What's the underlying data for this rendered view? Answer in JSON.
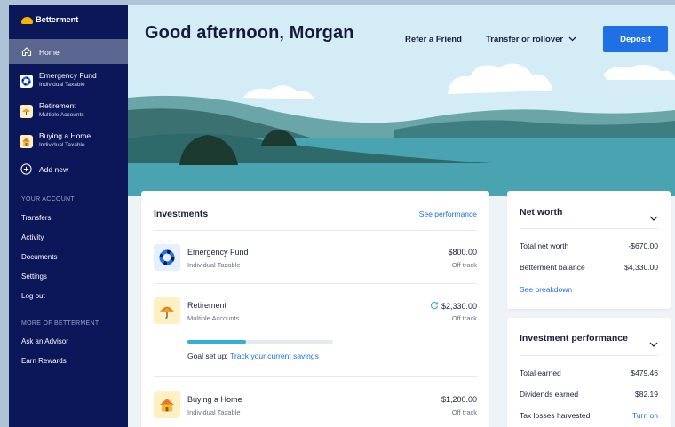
{
  "sidebar": {
    "brand": "Betterment",
    "nav": {
      "home": "Home",
      "accounts": [
        {
          "title": "Emergency Fund",
          "subtitle": "Individual Taxable",
          "icon": "life-ring-icon"
        },
        {
          "title": "Retirement",
          "subtitle": "Multiple Accounts",
          "icon": "umbrella-icon"
        },
        {
          "title": "Buying a Home",
          "subtitle": "Individual Taxable",
          "icon": "house-icon"
        }
      ],
      "add_new": "Add new"
    },
    "your_account": {
      "heading": "YOUR ACCOUNT",
      "links": [
        "Transfers",
        "Activity",
        "Documents",
        "Settings",
        "Log out"
      ]
    },
    "more": {
      "heading": "MORE OF BETTERMENT",
      "links": [
        "Ask an Advisor",
        "Earn Rewards"
      ]
    }
  },
  "header": {
    "greeting": "Good afternoon, Morgan",
    "refer": "Refer a Friend",
    "transfer": "Transfer or rollover",
    "deposit": "Deposit"
  },
  "investments": {
    "title": "Investments",
    "see_performance": "See performance",
    "accounts": [
      {
        "name": "Emergency Fund",
        "type": "Individual Taxable",
        "amount": "$800.00",
        "status": "Off track",
        "icon": "life-ring-icon"
      },
      {
        "name": "Retirement",
        "type": "Multiple Accounts",
        "amount": "$2,330.00",
        "status": "Off track",
        "icon": "umbrella-icon",
        "progress": 0.4,
        "goal_prefix": "Goal set up:",
        "goal_link": "Track your current savings"
      },
      {
        "name": "Buying a Home",
        "type": "Individual Taxable",
        "amount": "$1,200.00",
        "status": "Off track",
        "icon": "house-icon"
      }
    ]
  },
  "net_worth": {
    "title": "Net worth",
    "rows": [
      {
        "label": "Total net worth",
        "value": "-$670.00"
      },
      {
        "label": "Betterment balance",
        "value": "$4,330.00"
      }
    ],
    "breakdown": "See breakdown"
  },
  "investment_performance": {
    "title": "Investment performance",
    "rows": [
      {
        "label": "Total earned",
        "value": "$479.46"
      },
      {
        "label": "Dividends earned",
        "value": "$82.19"
      },
      {
        "label": "Tax losses harvested",
        "value": "Turn on"
      }
    ]
  },
  "colors": {
    "sidebar": "#0b1758",
    "accent": "#1f6fe5",
    "sky": "#d3ecf6",
    "water": "#4aa3b0"
  }
}
